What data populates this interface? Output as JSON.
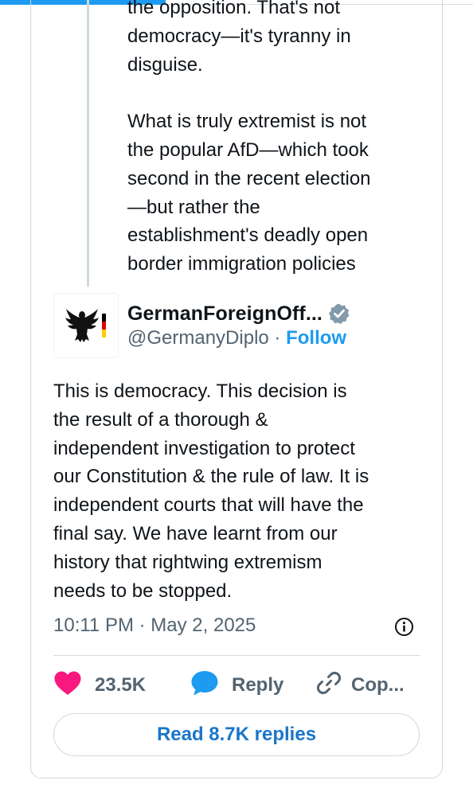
{
  "quoted_post": {
    "text_lines": "the opposition.  That's not\ndemocracy—it's tyranny in\ndisguise.\n\nWhat is truly extremist is not\nthe popular AfD—which took\nsecond in the recent election\n—but rather the\nestablishment's deadly open\nborder immigration policies"
  },
  "author": {
    "display_name": "GermanForeignOff...",
    "handle": "@GermanyDiplo",
    "separator": "·",
    "follow_label": "Follow",
    "avatar_icon": "federal-eagle-icon",
    "verified_icon": "verified-badge-icon"
  },
  "tweet": {
    "text": "This is democracy. This decision is\nthe result of a thorough &\nindependent investigation to protect\nour Constitution & the rule of law. It is\nindependent courts that will have the\nfinal say. We have learnt from our\nhistory that rightwing extremism\nneeds to be stopped.",
    "timestamp": "10:11 PM · May 2, 2025"
  },
  "actions": {
    "like_count": "23.5K",
    "reply_label": "Reply",
    "copy_label": "Cop..."
  },
  "read_replies_label": "Read 8.7K replies",
  "colors": {
    "accent": "#1d9bf0",
    "like": "#f91880",
    "text": "#0f1419",
    "muted": "#536471",
    "border": "#cfd9de"
  },
  "scroll_progress": 0.35
}
